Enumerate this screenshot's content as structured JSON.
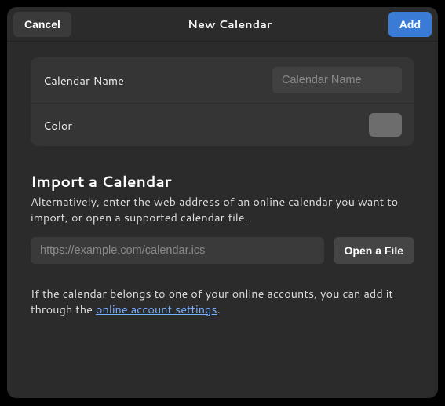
{
  "header": {
    "cancel_label": "Cancel",
    "title": "New Calendar",
    "add_label": "Add"
  },
  "form": {
    "name_label": "Calendar Name",
    "name_placeholder": "Calendar Name",
    "name_value": "",
    "color_label": "Color",
    "color_value": "#6d6d6d"
  },
  "import": {
    "heading": "Import a Calendar",
    "subtext": "Alternatively, enter the web address of an online calendar you want to import, or open a supported calendar file.",
    "url_placeholder": "https://example.com/calendar.ics",
    "url_value": "",
    "open_file_label": "Open a File",
    "note_before": "If the calendar belongs to one of your online accounts, you can add it through the ",
    "note_link": "online account settings",
    "note_after": "."
  }
}
